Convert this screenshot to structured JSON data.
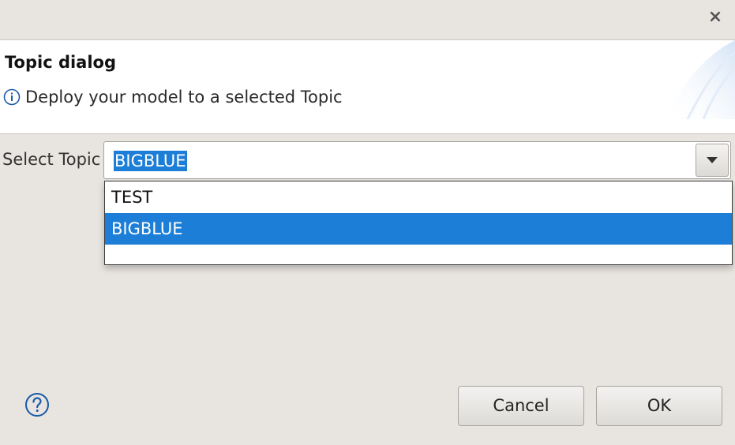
{
  "window": {
    "close_label": "×"
  },
  "header": {
    "title": "Topic dialog",
    "message": "Deploy your model to a selected Topic",
    "message_icon": "info-icon"
  },
  "form": {
    "select_label": "Select Topic",
    "selected_value": "BIGBLUE",
    "options": [
      "TEST",
      "BIGBLUE",
      ""
    ]
  },
  "footer": {
    "help_icon": "help-icon",
    "cancel_label": "Cancel",
    "ok_label": "OK"
  },
  "colors": {
    "selection": "#1c7ed6",
    "background": "#e8e5e1",
    "header_bg": "#ffffff",
    "info_icon": "#1a5aa8"
  }
}
